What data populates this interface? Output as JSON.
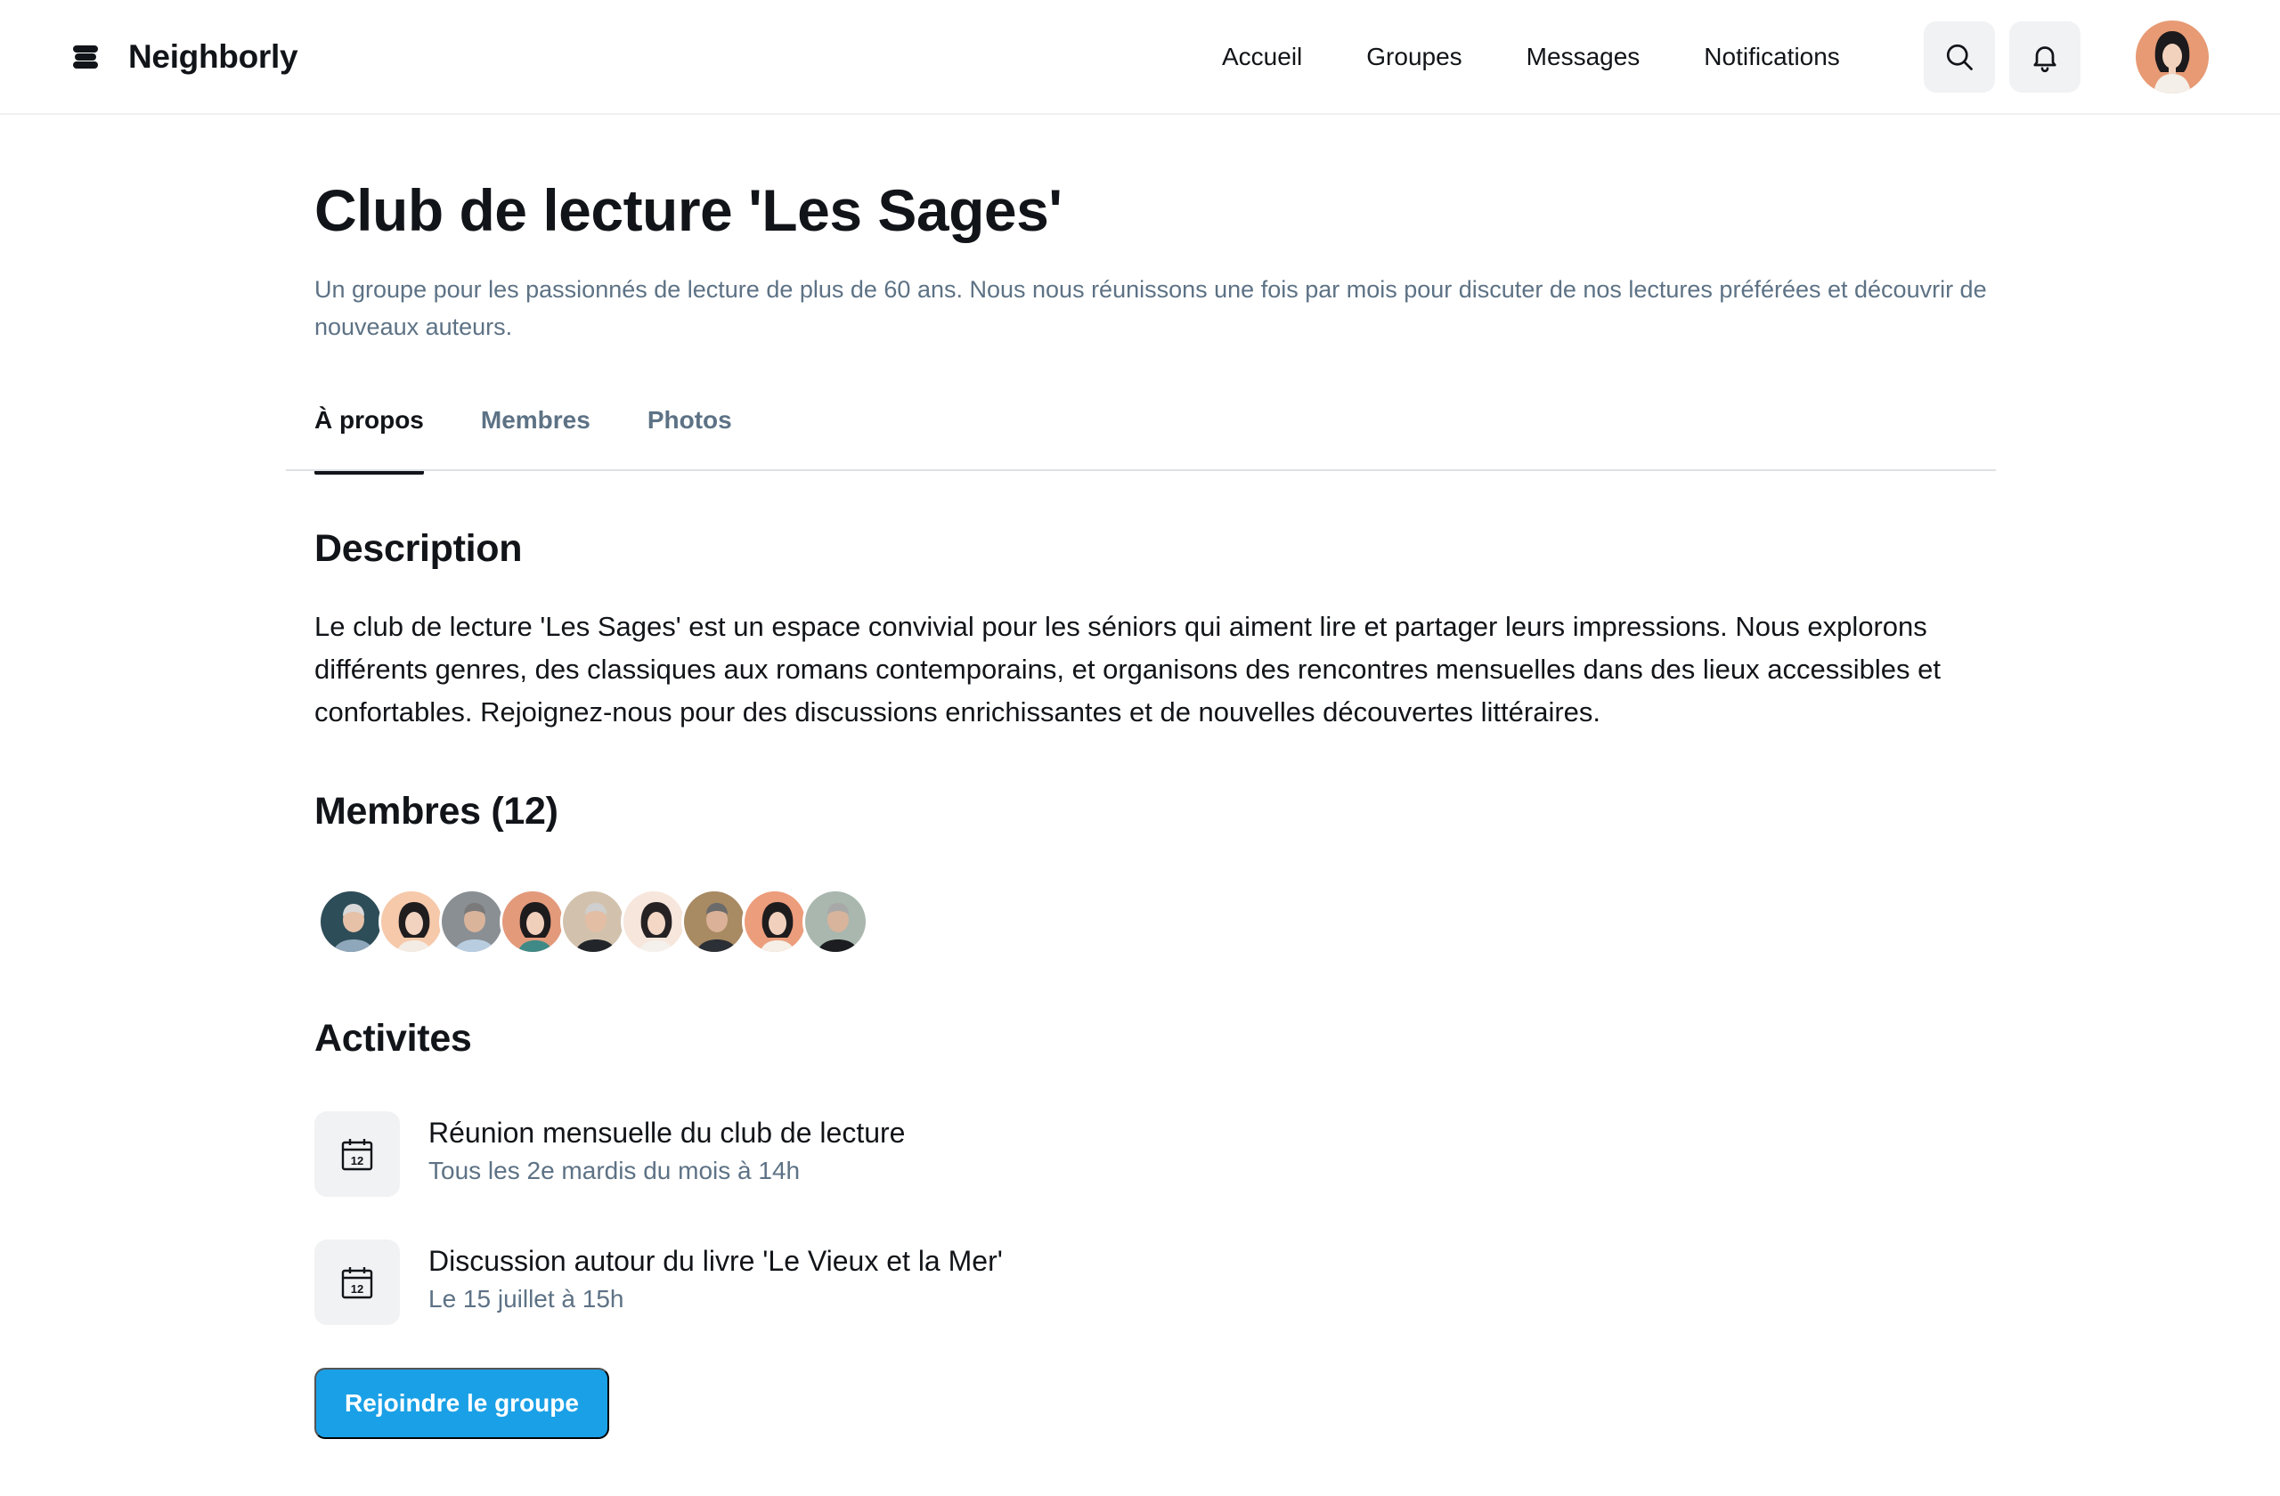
{
  "header": {
    "brand": "Neighborly",
    "nav": [
      "Accueil",
      "Groupes",
      "Messages",
      "Notifications"
    ],
    "icons": {
      "search": "search-icon",
      "notifications": "bell-icon"
    }
  },
  "group": {
    "title": "Club de lecture 'Les Sages'",
    "subtitle": "Un groupe pour les passionnés de lecture de plus de 60 ans. Nous nous réunissons une fois par mois pour discuter de nos lectures préférées et découvrir de nouveaux auteurs."
  },
  "tabs": [
    {
      "label": "À propos",
      "active": true
    },
    {
      "label": "Membres",
      "active": false
    },
    {
      "label": "Photos",
      "active": false
    }
  ],
  "description": {
    "heading": "Description",
    "text": "Le club de lecture 'Les Sages' est un espace convivial pour les séniors qui aiment lire et partager leurs impressions. Nous explorons différents genres, des classiques aux romans contemporains, et organisons des rencontres mensuelles dans des lieux accessibles et confortables. Rejoignez-nous pour des discussions enrichissantes et de nouvelles découvertes littéraires."
  },
  "members": {
    "heading": "Membres (12)",
    "count": 12,
    "visible_avatars": 9
  },
  "activities": {
    "heading": "Activites",
    "items": [
      {
        "title": "Réunion mensuelle du club de lecture",
        "when": "Tous les 2e mardis du mois à 14h",
        "icon": "calendar-icon",
        "icon_day": "12"
      },
      {
        "title": "Discussion autour du livre 'Le Vieux et la Mer'",
        "when": "Le 15 juillet à 15h",
        "icon": "calendar-icon",
        "icon_day": "12"
      }
    ]
  },
  "actions": {
    "join": "Rejoindre le groupe"
  },
  "colors": {
    "accent": "#1aa0e6",
    "muted_text": "#5d7285",
    "icon_bg": "#f0f2f4"
  }
}
